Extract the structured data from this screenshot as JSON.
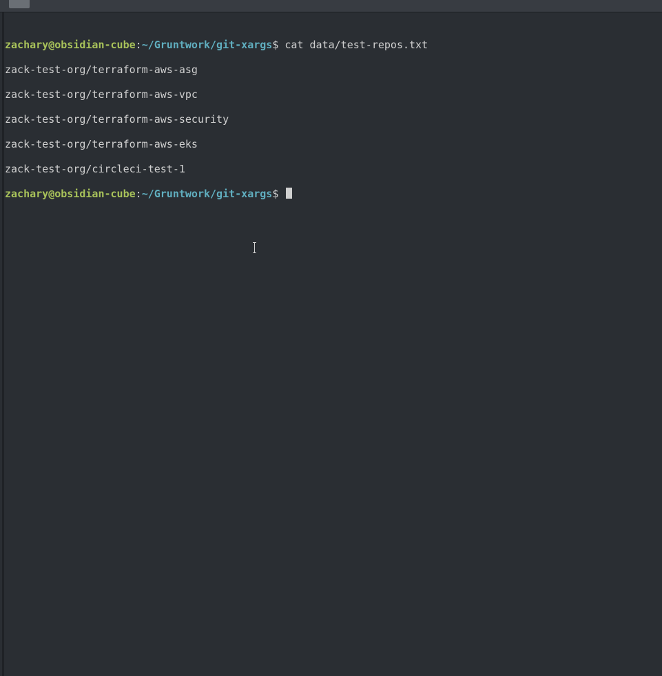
{
  "prompt1": {
    "user": "zachary@obsidian-cube",
    "colon": ":",
    "path": "~/Gruntwork/git-xargs",
    "dollar": "$ ",
    "command": "cat data/test-repos.txt"
  },
  "output": [
    "zack-test-org/terraform-aws-asg",
    "zack-test-org/terraform-aws-vpc",
    "zack-test-org/terraform-aws-security",
    "zack-test-org/terraform-aws-eks",
    "zack-test-org/circleci-test-1"
  ],
  "prompt2": {
    "user": "zachary@obsidian-cube",
    "colon": ":",
    "path": "~/Gruntwork/git-xargs",
    "dollar": "$ "
  }
}
